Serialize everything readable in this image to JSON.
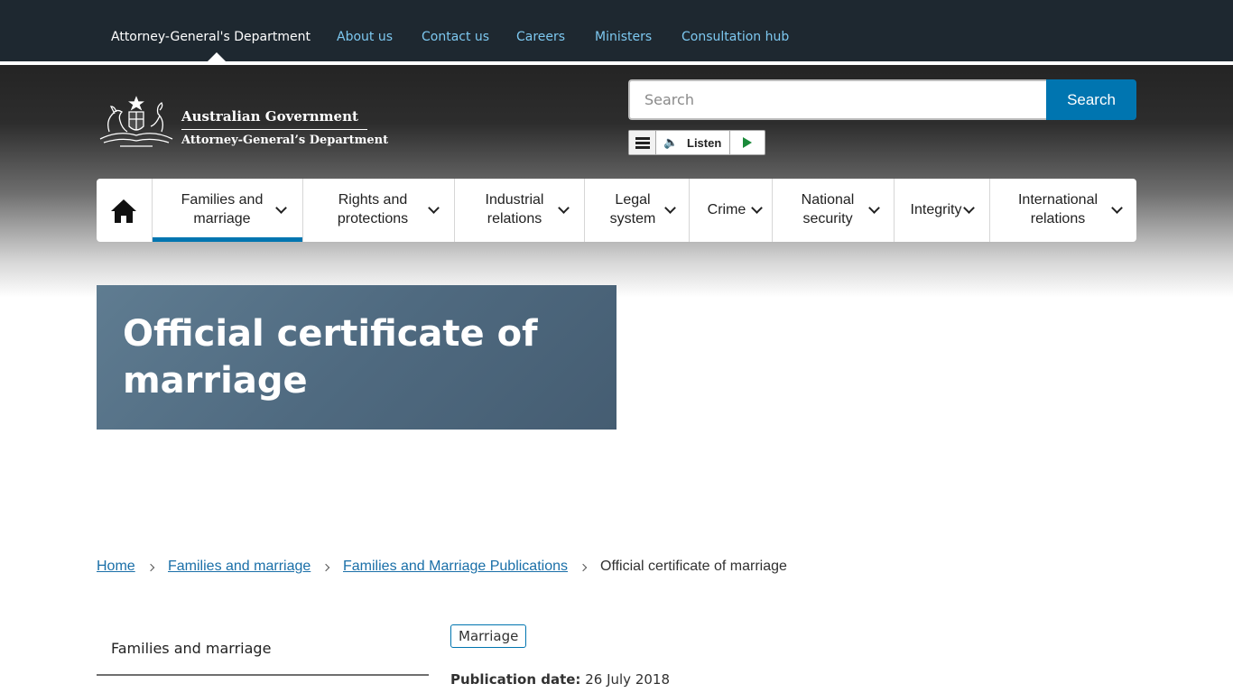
{
  "top_nav": {
    "items": [
      {
        "label": "Attorney-General's Department",
        "current": true
      },
      {
        "label": "About us"
      },
      {
        "label": "Contact us"
      },
      {
        "label": "Careers"
      },
      {
        "label": "Ministers"
      },
      {
        "label": "Consultation hub"
      }
    ]
  },
  "logo": {
    "line1": "Australian Government",
    "line2": "Attorney-General’s Department",
    "crest_icon": "coat-of-arms-icon"
  },
  "search": {
    "placeholder": "Search",
    "button_label": "Search"
  },
  "listen": {
    "label": "Listen",
    "menu_icon": "menu-icon",
    "speaker_icon": "speaker-icon",
    "play_icon": "play-icon"
  },
  "main_nav": {
    "home_icon": "home-icon",
    "items": [
      {
        "line1": "Families and",
        "line2": "marriage",
        "active": true
      },
      {
        "line1": "Rights and",
        "line2": "protections"
      },
      {
        "line1": "Industrial",
        "line2": "relations"
      },
      {
        "line1": "Legal",
        "line2": "system"
      },
      {
        "line1": "Crime",
        "line2": ""
      },
      {
        "line1": "National",
        "line2": "security"
      },
      {
        "line1": "Integrity",
        "line2": ""
      },
      {
        "line1": "International",
        "line2": "relations"
      }
    ]
  },
  "hero": {
    "title": "Official certificate of marriage"
  },
  "breadcrumb": [
    {
      "label": "Home"
    },
    {
      "label": "Families and marriage"
    },
    {
      "label": "Families and Marriage Publications"
    },
    {
      "label": "Official certificate of marriage",
      "current": true
    }
  ],
  "sidenav": {
    "title": "Families and marriage"
  },
  "content": {
    "tag": "Marriage",
    "pub_date_label": "Publication date:",
    "pub_date_value": "26 July 2018"
  },
  "colors": {
    "accent": "#0075b0",
    "topbar": "#1e2830",
    "link": "#1a6fa8"
  }
}
